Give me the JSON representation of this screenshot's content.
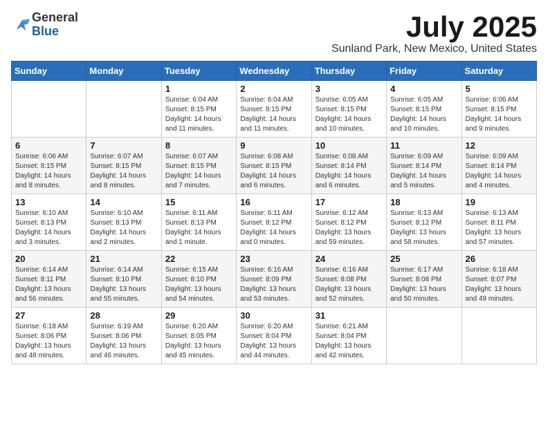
{
  "header": {
    "logo_line1": "General",
    "logo_line2": "Blue",
    "month_title": "July 2025",
    "location": "Sunland Park, New Mexico, United States"
  },
  "weekdays": [
    "Sunday",
    "Monday",
    "Tuesday",
    "Wednesday",
    "Thursday",
    "Friday",
    "Saturday"
  ],
  "weeks": [
    [
      null,
      null,
      {
        "day": 1,
        "sunrise": "Sunrise: 6:04 AM",
        "sunset": "Sunset: 8:15 PM",
        "daylight": "Daylight: 14 hours and 11 minutes."
      },
      {
        "day": 2,
        "sunrise": "Sunrise: 6:04 AM",
        "sunset": "Sunset: 8:15 PM",
        "daylight": "Daylight: 14 hours and 11 minutes."
      },
      {
        "day": 3,
        "sunrise": "Sunrise: 6:05 AM",
        "sunset": "Sunset: 8:15 PM",
        "daylight": "Daylight: 14 hours and 10 minutes."
      },
      {
        "day": 4,
        "sunrise": "Sunrise: 6:05 AM",
        "sunset": "Sunset: 8:15 PM",
        "daylight": "Daylight: 14 hours and 10 minutes."
      },
      {
        "day": 5,
        "sunrise": "Sunrise: 6:06 AM",
        "sunset": "Sunset: 8:15 PM",
        "daylight": "Daylight: 14 hours and 9 minutes."
      }
    ],
    [
      {
        "day": 6,
        "sunrise": "Sunrise: 6:06 AM",
        "sunset": "Sunset: 8:15 PM",
        "daylight": "Daylight: 14 hours and 8 minutes."
      },
      {
        "day": 7,
        "sunrise": "Sunrise: 6:07 AM",
        "sunset": "Sunset: 8:15 PM",
        "daylight": "Daylight: 14 hours and 8 minutes."
      },
      {
        "day": 8,
        "sunrise": "Sunrise: 6:07 AM",
        "sunset": "Sunset: 8:15 PM",
        "daylight": "Daylight: 14 hours and 7 minutes."
      },
      {
        "day": 9,
        "sunrise": "Sunrise: 6:08 AM",
        "sunset": "Sunset: 8:15 PM",
        "daylight": "Daylight: 14 hours and 6 minutes."
      },
      {
        "day": 10,
        "sunrise": "Sunrise: 6:08 AM",
        "sunset": "Sunset: 8:14 PM",
        "daylight": "Daylight: 14 hours and 6 minutes."
      },
      {
        "day": 11,
        "sunrise": "Sunrise: 6:09 AM",
        "sunset": "Sunset: 8:14 PM",
        "daylight": "Daylight: 14 hours and 5 minutes."
      },
      {
        "day": 12,
        "sunrise": "Sunrise: 6:09 AM",
        "sunset": "Sunset: 8:14 PM",
        "daylight": "Daylight: 14 hours and 4 minutes."
      }
    ],
    [
      {
        "day": 13,
        "sunrise": "Sunrise: 6:10 AM",
        "sunset": "Sunset: 8:13 PM",
        "daylight": "Daylight: 14 hours and 3 minutes."
      },
      {
        "day": 14,
        "sunrise": "Sunrise: 6:10 AM",
        "sunset": "Sunset: 8:13 PM",
        "daylight": "Daylight: 14 hours and 2 minutes."
      },
      {
        "day": 15,
        "sunrise": "Sunrise: 6:11 AM",
        "sunset": "Sunset: 8:13 PM",
        "daylight": "Daylight: 14 hours and 1 minute."
      },
      {
        "day": 16,
        "sunrise": "Sunrise: 6:11 AM",
        "sunset": "Sunset: 8:12 PM",
        "daylight": "Daylight: 14 hours and 0 minutes."
      },
      {
        "day": 17,
        "sunrise": "Sunrise: 6:12 AM",
        "sunset": "Sunset: 8:12 PM",
        "daylight": "Daylight: 13 hours and 59 minutes."
      },
      {
        "day": 18,
        "sunrise": "Sunrise: 6:13 AM",
        "sunset": "Sunset: 8:12 PM",
        "daylight": "Daylight: 13 hours and 58 minutes."
      },
      {
        "day": 19,
        "sunrise": "Sunrise: 6:13 AM",
        "sunset": "Sunset: 8:11 PM",
        "daylight": "Daylight: 13 hours and 57 minutes."
      }
    ],
    [
      {
        "day": 20,
        "sunrise": "Sunrise: 6:14 AM",
        "sunset": "Sunset: 8:11 PM",
        "daylight": "Daylight: 13 hours and 56 minutes."
      },
      {
        "day": 21,
        "sunrise": "Sunrise: 6:14 AM",
        "sunset": "Sunset: 8:10 PM",
        "daylight": "Daylight: 13 hours and 55 minutes."
      },
      {
        "day": 22,
        "sunrise": "Sunrise: 6:15 AM",
        "sunset": "Sunset: 8:10 PM",
        "daylight": "Daylight: 13 hours and 54 minutes."
      },
      {
        "day": 23,
        "sunrise": "Sunrise: 6:16 AM",
        "sunset": "Sunset: 8:09 PM",
        "daylight": "Daylight: 13 hours and 53 minutes."
      },
      {
        "day": 24,
        "sunrise": "Sunrise: 6:16 AM",
        "sunset": "Sunset: 8:08 PM",
        "daylight": "Daylight: 13 hours and 52 minutes."
      },
      {
        "day": 25,
        "sunrise": "Sunrise: 6:17 AM",
        "sunset": "Sunset: 8:08 PM",
        "daylight": "Daylight: 13 hours and 50 minutes."
      },
      {
        "day": 26,
        "sunrise": "Sunrise: 6:18 AM",
        "sunset": "Sunset: 8:07 PM",
        "daylight": "Daylight: 13 hours and 49 minutes."
      }
    ],
    [
      {
        "day": 27,
        "sunrise": "Sunrise: 6:18 AM",
        "sunset": "Sunset: 8:06 PM",
        "daylight": "Daylight: 13 hours and 48 minutes."
      },
      {
        "day": 28,
        "sunrise": "Sunrise: 6:19 AM",
        "sunset": "Sunset: 8:06 PM",
        "daylight": "Daylight: 13 hours and 46 minutes."
      },
      {
        "day": 29,
        "sunrise": "Sunrise: 6:20 AM",
        "sunset": "Sunset: 8:05 PM",
        "daylight": "Daylight: 13 hours and 45 minutes."
      },
      {
        "day": 30,
        "sunrise": "Sunrise: 6:20 AM",
        "sunset": "Sunset: 8:04 PM",
        "daylight": "Daylight: 13 hours and 44 minutes."
      },
      {
        "day": 31,
        "sunrise": "Sunrise: 6:21 AM",
        "sunset": "Sunset: 8:04 PM",
        "daylight": "Daylight: 13 hours and 42 minutes."
      },
      null,
      null
    ]
  ]
}
